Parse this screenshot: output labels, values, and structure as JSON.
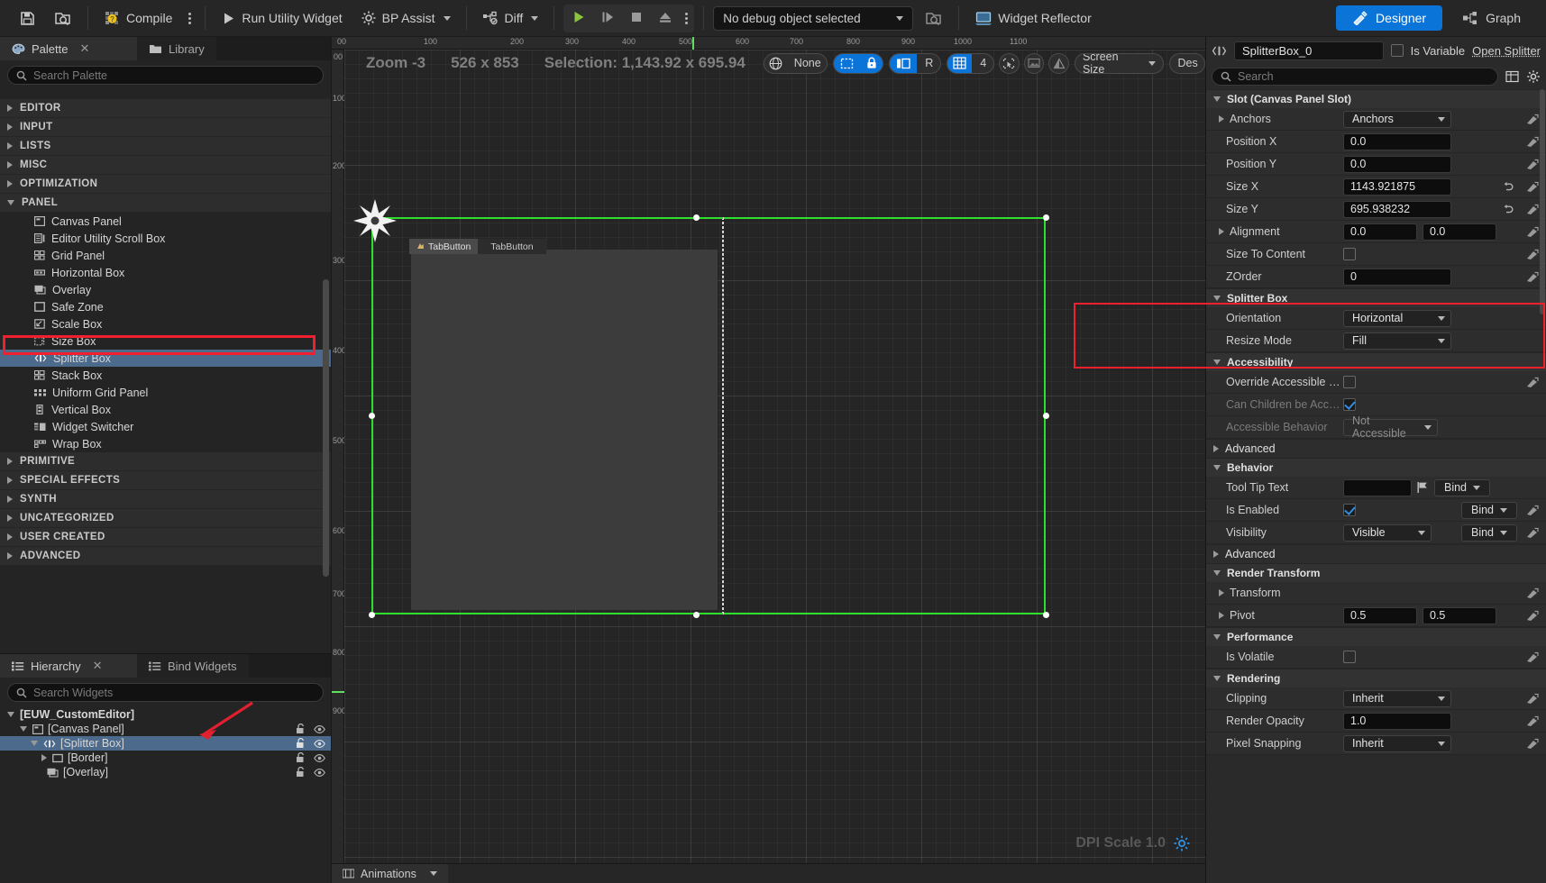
{
  "toolbar": {
    "save_label": "",
    "compile_label": "Compile",
    "run_utility_widget_label": "Run Utility Widget",
    "bp_assist_label": "BP Assist",
    "diff_label": "Diff",
    "debug_object_label": "No debug object selected",
    "widget_reflector_label": "Widget Reflector",
    "designer_label": "Designer",
    "graph_label": "Graph",
    "icons": {
      "save": "save-icon",
      "browse": "find-in-content-browser-icon",
      "compile": "compile-status-icon",
      "kebab": "overflow-menu-icon",
      "run": "play-triangle-icon",
      "bp_assist": "gear-icon",
      "diff": "diff-icon",
      "play": "play-icon",
      "step": "frame-step-icon",
      "stop": "stop-icon",
      "eject": "eject-icon",
      "reflector": "widget-reflector-icon",
      "designer": "designer-brush-icon",
      "graph": "graph-nodes-icon"
    }
  },
  "palette": {
    "tabs": [
      {
        "label": "Palette",
        "icon": "palette-icon",
        "active": true,
        "closable": true
      },
      {
        "label": "Library",
        "icon": "folder-icon",
        "active": false,
        "closable": false
      }
    ],
    "search_placeholder": "Search Palette",
    "categories": [
      {
        "label": "EDITOR",
        "open": false
      },
      {
        "label": "INPUT",
        "open": false
      },
      {
        "label": "LISTS",
        "open": false
      },
      {
        "label": "MISC",
        "open": false
      },
      {
        "label": "OPTIMIZATION",
        "open": false
      },
      {
        "label": "PANEL",
        "open": true
      }
    ],
    "panel_items": [
      {
        "label": "Canvas Panel",
        "icon": "canvas-panel-icon",
        "selected": false
      },
      {
        "label": "Editor Utility Scroll Box",
        "icon": "scroll-box-icon",
        "selected": false
      },
      {
        "label": "Grid Panel",
        "icon": "grid-panel-icon",
        "selected": false
      },
      {
        "label": "Horizontal Box",
        "icon": "horizontal-box-icon",
        "selected": false
      },
      {
        "label": "Overlay",
        "icon": "overlay-icon",
        "selected": false
      },
      {
        "label": "Safe Zone",
        "icon": "safe-zone-icon",
        "selected": false
      },
      {
        "label": "Scale Box",
        "icon": "scale-box-icon",
        "selected": false
      },
      {
        "label": "Size Box",
        "icon": "size-box-icon",
        "selected": false
      },
      {
        "label": "Splitter Box",
        "icon": "splitter-box-icon",
        "selected": true
      },
      {
        "label": "Stack Box",
        "icon": "stack-box-icon",
        "selected": false
      },
      {
        "label": "Uniform Grid Panel",
        "icon": "uniform-grid-icon",
        "selected": false
      },
      {
        "label": "Vertical Box",
        "icon": "vertical-box-icon",
        "selected": false
      },
      {
        "label": "Widget Switcher",
        "icon": "widget-switcher-icon",
        "selected": false
      },
      {
        "label": "Wrap Box",
        "icon": "wrap-box-icon",
        "selected": false
      }
    ],
    "categories_after": [
      {
        "label": "PRIMITIVE",
        "open": false
      },
      {
        "label": "SPECIAL EFFECTS",
        "open": false
      },
      {
        "label": "SYNTH",
        "open": false
      },
      {
        "label": "UNCATEGORIZED",
        "open": false
      },
      {
        "label": "USER CREATED",
        "open": false
      },
      {
        "label": "ADVANCED",
        "open": false
      }
    ]
  },
  "hierarchy": {
    "tabs": [
      {
        "label": "Hierarchy",
        "icon": "hierarchy-icon",
        "active": true,
        "closable": true
      },
      {
        "label": "Bind Widgets",
        "icon": "bind-widgets-icon",
        "active": false,
        "closable": false
      }
    ],
    "search_placeholder": "Search Widgets",
    "rows": [
      {
        "label": "[EUW_CustomEditor]",
        "depth": 0,
        "expander": "open",
        "icon": "",
        "selected": false,
        "lock": false,
        "eye": false
      },
      {
        "label": "[Canvas Panel]",
        "depth": 1,
        "expander": "open",
        "icon": "canvas-panel-icon",
        "selected": false,
        "lock": true,
        "eye": true
      },
      {
        "label": "[Splitter Box]",
        "depth": 2,
        "expander": "open",
        "icon": "splitter-box-icon",
        "selected": true,
        "lock": true,
        "eye": true
      },
      {
        "label": "[Border]",
        "depth": 3,
        "expander": "closed",
        "icon": "border-icon",
        "selected": false,
        "lock": true,
        "eye": true
      },
      {
        "label": "[Overlay]",
        "depth": 3,
        "expander": "none",
        "icon": "overlay-icon",
        "selected": false,
        "lock": true,
        "eye": true
      }
    ]
  },
  "designer": {
    "zoom_label": "Zoom -3",
    "resolution_label": "526 x 853",
    "selection_label": "Selection: 1,143.92 x 695.94",
    "locale_label": "None",
    "fill_screen_icon": "fill-screen-icon",
    "lock_icon": "lock-icon",
    "mirror_icon": "mirror-icon",
    "rtl_label": "R",
    "grid_icon": "grid-snap-icon",
    "grid_value": "4",
    "outline_icon": "outline-icon",
    "image_icon": "image-icon",
    "contrast_icon": "contrast-icon",
    "screen_size_label": "Screen Size",
    "desired_label": "Des",
    "dpi_label": "DPI Scale 1.0",
    "dpi_icon": "gear-icon",
    "ruler_h_labels": [
      "00",
      "100",
      "200",
      "300",
      "400",
      "500",
      "600",
      "700",
      "800",
      "900",
      "1000",
      "1100"
    ],
    "ruler_v_labels": [
      "00",
      "100",
      "200",
      "300",
      "400",
      "500",
      "600",
      "700",
      "800",
      "900"
    ],
    "selected_widget_tab_label": "TabButton",
    "selected_widget_tab2_label": "TabButton"
  },
  "details": {
    "widget_name": "SplitterBox_0",
    "widget_name_icon": "splitter-box-icon",
    "is_variable_label": "Is Variable",
    "is_variable_checked": false,
    "open_splitter_label": "Open Splitter",
    "search_placeholder": "Search",
    "column_icon": "columns-icon",
    "settings_icon": "gear-icon",
    "sections": [
      {
        "title": "Slot (Canvas Panel Slot)",
        "open": true,
        "rows": [
          {
            "label": "Anchors",
            "type": "dropdown",
            "value": "Anchors",
            "expander": true,
            "reset": true
          },
          {
            "label": "Position X",
            "type": "input",
            "value": "0.0",
            "reset": true
          },
          {
            "label": "Position Y",
            "type": "input",
            "value": "0.0",
            "reset": true
          },
          {
            "label": "Size X",
            "type": "input",
            "value": "1143.921875",
            "revert": true,
            "reset": true
          },
          {
            "label": "Size Y",
            "type": "input",
            "value": "695.938232",
            "revert": true,
            "reset": true
          },
          {
            "label": "Alignment",
            "type": "input2",
            "value": "0.0",
            "value2": "0.0",
            "expander": true,
            "reset": true
          },
          {
            "label": "Size To Content",
            "type": "checkbox",
            "checked": false,
            "reset": true
          },
          {
            "label": "ZOrder",
            "type": "input",
            "value": "0",
            "reset": true
          }
        ]
      },
      {
        "title": "Splitter Box",
        "open": true,
        "highlighted": true,
        "rows": [
          {
            "label": "Orientation",
            "type": "dropdown",
            "value": "Horizontal"
          },
          {
            "label": "Resize Mode",
            "type": "dropdown",
            "value": "Fill"
          }
        ]
      },
      {
        "title": "Accessibility",
        "open": true,
        "rows": [
          {
            "label": "Override Accessible Def...",
            "type": "checkbox",
            "checked": false,
            "reset": true
          },
          {
            "label": "Can Children be Accessi...",
            "type": "checkbox",
            "checked": true,
            "dim": true
          },
          {
            "label": "Accessible Behavior",
            "type": "dropdown",
            "value": "Not Accessible",
            "dim": true
          }
        ]
      },
      {
        "title": "Advanced",
        "open": false,
        "collapsed_only": true,
        "rows": []
      },
      {
        "title": "Behavior",
        "open": true,
        "rows": [
          {
            "label": "Tool Tip Text",
            "type": "text-flag-bind",
            "value": "",
            "bind_label": "Bind"
          },
          {
            "label": "Is Enabled",
            "type": "checkbox-bind",
            "checked": true,
            "bind_label": "Bind",
            "reset": true
          },
          {
            "label": "Visibility",
            "type": "dropdown-bind",
            "value": "Visible",
            "bind_label": "Bind",
            "reset": true
          }
        ]
      },
      {
        "title": "Advanced",
        "open": false,
        "collapsed_only": true,
        "rows": []
      },
      {
        "title": "Render Transform",
        "open": true,
        "rows": [
          {
            "label": "Transform",
            "type": "empty",
            "expander": true,
            "reset": true
          },
          {
            "label": "Pivot",
            "type": "input2",
            "value": "0.5",
            "value2": "0.5",
            "expander": true,
            "reset": true
          }
        ]
      },
      {
        "title": "Performance",
        "open": true,
        "rows": [
          {
            "label": "Is Volatile",
            "type": "checkbox",
            "checked": false,
            "reset": true
          }
        ]
      },
      {
        "title": "Rendering",
        "open": true,
        "rows": [
          {
            "label": "Clipping",
            "type": "dropdown",
            "value": "Inherit",
            "reset": true
          },
          {
            "label": "Render Opacity",
            "type": "input",
            "value": "1.0",
            "reset": true
          },
          {
            "label": "Pixel Snapping",
            "type": "dropdown",
            "value": "Inherit",
            "reset": true
          }
        ]
      }
    ]
  },
  "bottom": {
    "animations_label": "Animations"
  },
  "colors": {
    "accent_blue": "#0b74d8",
    "selection_green": "#2ee02e",
    "annotation_red": "#f21f2e",
    "row_selected": "#4c6a8c"
  }
}
